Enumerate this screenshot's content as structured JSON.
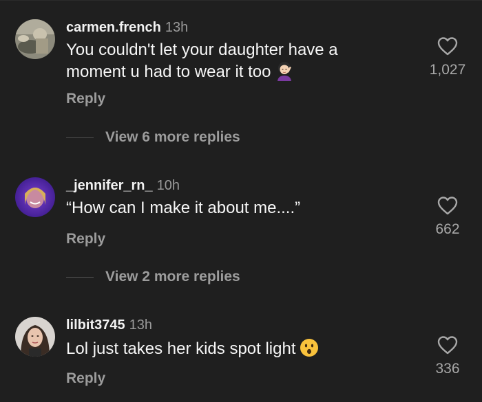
{
  "comments": [
    {
      "username": "carmen.french",
      "time": "13h",
      "text_line1": "You couldn't let your daughter have  a",
      "text_line2": "moment u had to wear it too",
      "emoji": "woman-facepalming-emoji",
      "likes": "1,027",
      "reply_label": "Reply",
      "view_more": "View 6 more replies"
    },
    {
      "username": "_jennifer_rn_",
      "time": "10h",
      "text": "“How can I make it about me....”",
      "likes": "662",
      "reply_label": "Reply",
      "view_more": "View 2 more replies"
    },
    {
      "username": "lilbit3745",
      "time": "13h",
      "text": "Lol just takes her kids spot light",
      "emoji": "surprised-face-emoji",
      "likes": "336",
      "reply_label": "Reply"
    }
  ],
  "icons": {
    "like": "heart-outline-icon"
  },
  "colors": {
    "background": "#1f1f1f",
    "primary_text": "#f2f2f2",
    "secondary_text": "#9a9a9a",
    "like_count": "#a8a8a8"
  }
}
